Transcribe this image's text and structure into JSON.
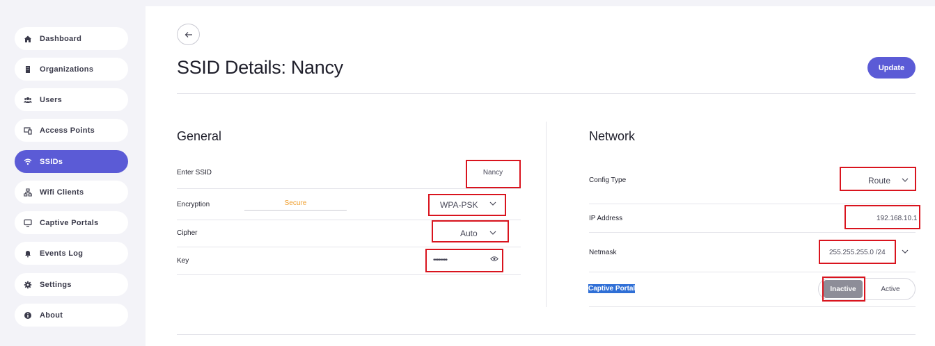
{
  "sidebar": {
    "items": [
      {
        "label": "Dashboard",
        "icon": "home-icon"
      },
      {
        "label": "Organizations",
        "icon": "building-icon"
      },
      {
        "label": "Users",
        "icon": "users-icon"
      },
      {
        "label": "Access Points",
        "icon": "access-point-icon"
      },
      {
        "label": "SSIDs",
        "icon": "wifi-icon",
        "active": true
      },
      {
        "label": "Wifi Clients",
        "icon": "network-icon"
      },
      {
        "label": "Captive Portals",
        "icon": "monitor-icon"
      },
      {
        "label": "Events Log",
        "icon": "bell-icon"
      },
      {
        "label": "Settings",
        "icon": "gear-icon"
      },
      {
        "label": "About",
        "icon": "info-icon"
      }
    ]
  },
  "header": {
    "title": "SSID Details: Nancy",
    "update_label": "Update"
  },
  "general": {
    "title": "General",
    "ssid_label": "Enter SSID",
    "ssid_value": "Nancy",
    "encryption_label": "Encryption",
    "encryption_strength": "Secure",
    "encryption_value": "WPA-PSK",
    "cipher_label": "Cipher",
    "cipher_value": "Auto",
    "key_label": "Key",
    "key_value": "••••••••"
  },
  "network": {
    "title": "Network",
    "config_type_label": "Config Type",
    "config_type_value": "Route",
    "ip_label": "IP Address",
    "ip_value": "192.168.10.1",
    "netmask_label": "Netmask",
    "netmask_value": "255.255.255.0 /24",
    "captive_label": "Captive Portal",
    "captive_inactive": "Inactive",
    "captive_active": "Active"
  },
  "colors": {
    "accent": "#5b5bd6",
    "highlight_box": "#d9141e",
    "secure_text": "#f0a030"
  }
}
